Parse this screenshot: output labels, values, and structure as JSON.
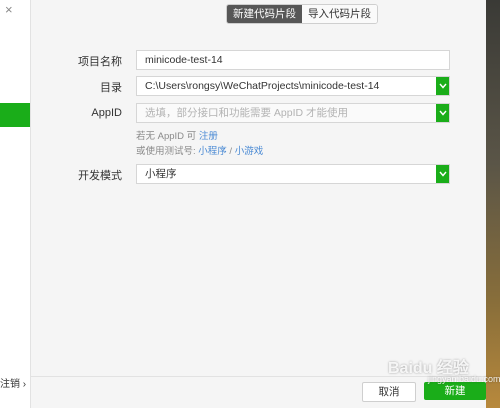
{
  "window": {
    "close_glyph": "×"
  },
  "sidebar": {
    "logout_label": "注销 ›"
  },
  "tabs": [
    {
      "label": "新建代码片段",
      "active": true
    },
    {
      "label": "导入代码片段",
      "active": false
    }
  ],
  "form": {
    "project_name": {
      "label": "项目名称",
      "value": "minicode-test-14"
    },
    "directory": {
      "label": "目录",
      "value": "C:\\Users\\rongsy\\WeChatProjects\\minicode-test-14"
    },
    "appid": {
      "label": "AppID",
      "placeholder": "选填，部分接口和功能需要 AppID 才能使用",
      "hint1_prefix": "若无 AppID 可 ",
      "hint1_link": "注册",
      "hint2_prefix": "或使用测试号: ",
      "hint2_link_a": "小程序",
      "hint2_sep": " / ",
      "hint2_link_b": "小游戏"
    },
    "dev_mode": {
      "label": "开发模式",
      "value": "小程序"
    }
  },
  "footer": {
    "cancel_label": "取消",
    "create_label": "新建"
  },
  "watermark": {
    "text": "Baidu 经验",
    "sub": "jingyan.baidu.com"
  },
  "colors": {
    "accent": "#1aad19",
    "tab_active": "#575757",
    "link": "#4a8ad4"
  }
}
